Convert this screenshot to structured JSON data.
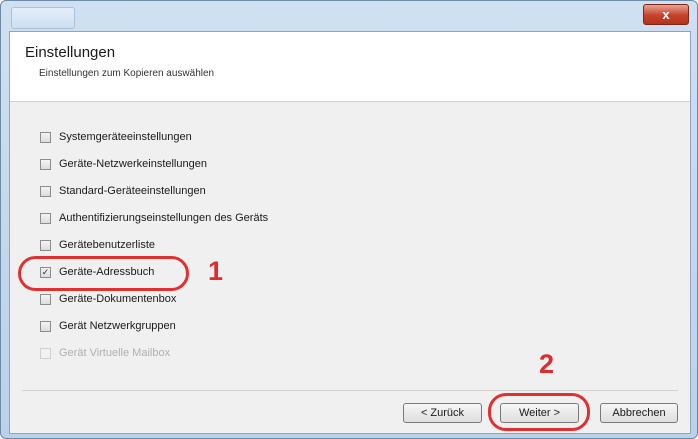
{
  "window": {
    "close_glyph": "x"
  },
  "header": {
    "title": "Einstellungen",
    "subtitle": "Einstellungen zum Kopieren auswählen"
  },
  "options": [
    {
      "label": "Systemgeräteeinstellungen",
      "checked": false,
      "enabled": true
    },
    {
      "label": "Geräte-Netzwerkeinstellungen",
      "checked": false,
      "enabled": true
    },
    {
      "label": "Standard-Geräteeinstellungen",
      "checked": false,
      "enabled": true
    },
    {
      "label": "Authentifizierungseinstellungen des Geräts",
      "checked": false,
      "enabled": true
    },
    {
      "label": "Gerätebenutzerliste",
      "checked": false,
      "enabled": true
    },
    {
      "label": "Geräte-Adressbuch",
      "checked": true,
      "enabled": true
    },
    {
      "label": "Geräte-Dokumentenbox",
      "checked": false,
      "enabled": true
    },
    {
      "label": "Gerät Netzwerkgruppen",
      "checked": false,
      "enabled": true
    },
    {
      "label": "Gerät Virtuelle Mailbox",
      "checked": false,
      "enabled": false
    }
  ],
  "annotations": {
    "step1": "1",
    "step2": "2"
  },
  "buttons": {
    "back": "< Zurück",
    "next": "Weiter >",
    "cancel": "Abbrechen"
  },
  "colors": {
    "highlight": "#e03030",
    "annotation": "#e02b2b"
  }
}
